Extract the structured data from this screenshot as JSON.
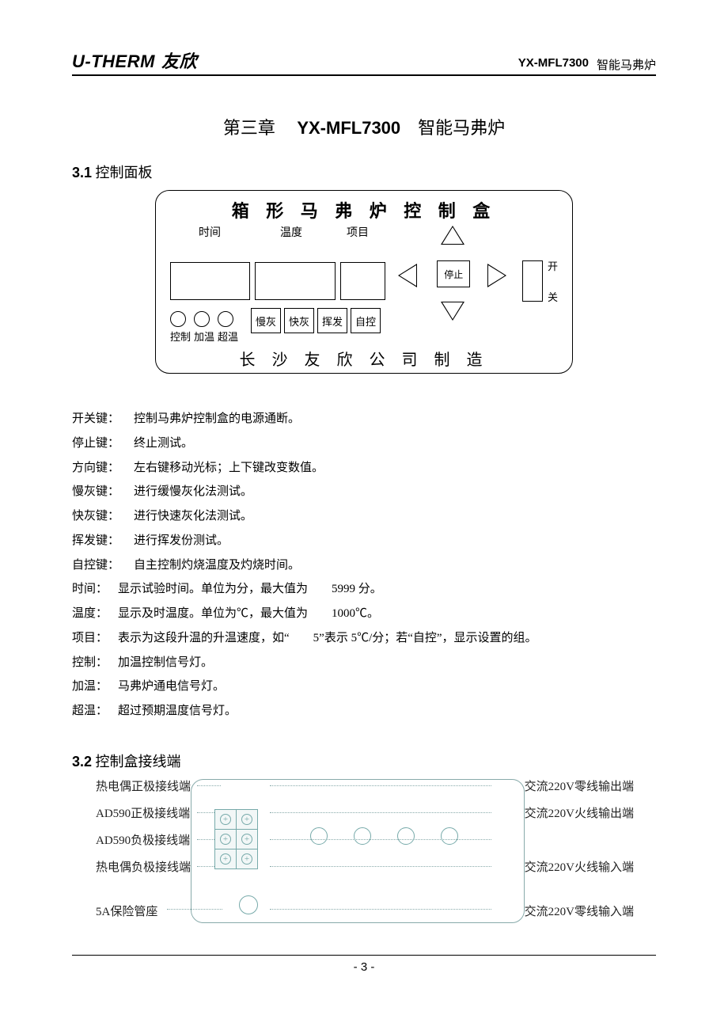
{
  "header": {
    "brand_en": "U-THERM",
    "brand_cn": "友欣",
    "model": "YX-MFL7300",
    "product": "智能马弗炉"
  },
  "chapter": {
    "label": "第三章",
    "model": "YX-MFL7300",
    "product": "智能马弗炉"
  },
  "section31": {
    "num": "3.1",
    "title": "控制面板"
  },
  "panel": {
    "title": "箱 形 马 弗 炉 控 制 盒",
    "lbl_time": "时间",
    "lbl_temp": "温度",
    "lbl_item": "项目",
    "stop": "停止",
    "on": "开",
    "off": "关",
    "led1": "控制",
    "led2": "加温",
    "led3": "超温",
    "btn_slow": "慢灰",
    "btn_fast": "快灰",
    "btn_vol": "挥发",
    "btn_auto": "自控",
    "maker": "长 沙 友 欣 公 司 制 造"
  },
  "defs": [
    {
      "term": "开关键：",
      "desc": "控制马弗炉控制盒的电源通断。"
    },
    {
      "term": "停止键：",
      "desc": "终止测试。"
    },
    {
      "term": "方向键：",
      "desc": "左右键移动光标；上下键改变数值。"
    },
    {
      "term": "慢灰键：",
      "desc": "进行缓慢灰化法测试。"
    },
    {
      "term": "快灰键：",
      "desc": "进行快速灰化法测试。"
    },
    {
      "term": "挥发键：",
      "desc": "进行挥发份测试。"
    },
    {
      "term": "自控键：",
      "desc": "自主控制灼烧温度及灼烧时间。"
    },
    {
      "term": "时间：",
      "desc": "显示试验时间。单位为分，最大值为　　5999 分。"
    },
    {
      "term": "温度：",
      "desc": "显示及时温度。单位为℃，最大值为　　1000℃。"
    },
    {
      "term": "项目：",
      "desc": "表示为这段升温的升温速度，如“　　5”表示 5℃/分；若“自控”，显示设置的组。"
    },
    {
      "term": "控制：",
      "desc": "加温控制信号灯。"
    },
    {
      "term": "加温：",
      "desc": "马弗炉通电信号灯。"
    },
    {
      "term": "超温：",
      "desc": "超过预期温度信号灯。"
    }
  ],
  "section32": {
    "num": "3.2",
    "title": "控制盒接线端"
  },
  "wiring": {
    "left": [
      "热电偶正极接线端",
      "AD590正极接线端",
      "AD590负极接线端",
      "热电偶负极接线端",
      "5A保险管座"
    ],
    "right": [
      "交流220V零线输出端",
      "交流220V火线输出端",
      "交流220V火线输入端",
      "交流220V零线输入端"
    ]
  },
  "page_number": "- 3 -"
}
